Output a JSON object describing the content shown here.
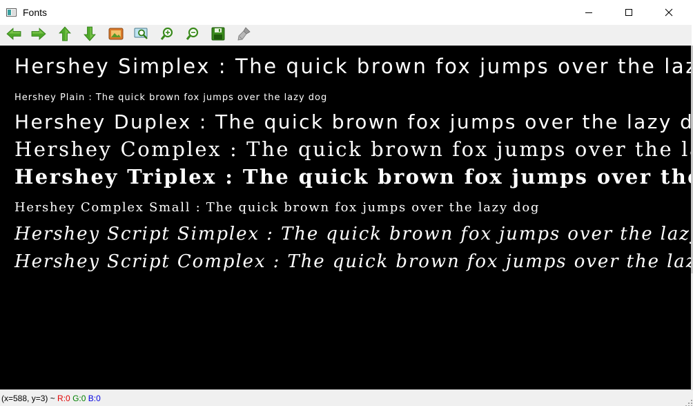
{
  "window": {
    "title": "Fonts"
  },
  "toolbar": {
    "buttons": [
      {
        "icon": "arrow-left-icon",
        "name": "pan-left-button"
      },
      {
        "icon": "arrow-right-icon",
        "name": "pan-right-button"
      },
      {
        "icon": "arrow-up-icon",
        "name": "pan-up-button"
      },
      {
        "icon": "arrow-down-icon",
        "name": "pan-down-button"
      },
      {
        "icon": "image-icon",
        "name": "zoom-original-button"
      },
      {
        "icon": "zoom-fit-icon",
        "name": "zoom-fit-button"
      },
      {
        "icon": "zoom-in-icon",
        "name": "zoom-in-button"
      },
      {
        "icon": "zoom-out-icon",
        "name": "zoom-out-button"
      },
      {
        "icon": "save-icon",
        "name": "save-button"
      },
      {
        "icon": "properties-brush-icon",
        "name": "properties-button"
      }
    ],
    "accent_color": "#4fa82a"
  },
  "canvas": {
    "background": "#000000",
    "text_color": "#ffffff",
    "lines": [
      {
        "text": "Hershey Simplex : The quick brown fox jumps over the lazy dog",
        "style": "simplex"
      },
      {
        "text": "Hershey Plain : The quick brown fox jumps over the lazy dog",
        "style": "plain"
      },
      {
        "text": "Hershey Duplex : The quick brown fox jumps over the lazy dog",
        "style": "duplex"
      },
      {
        "text": "Hershey Complex : The quick brown fox jumps over the lazy dog",
        "style": "complex"
      },
      {
        "text": "Hershey Triplex : The quick brown fox jumps over the lazy dog",
        "style": "triplex"
      },
      {
        "text": "Hershey Complex Small : The quick brown fox jumps over the lazy dog",
        "style": "complex-small"
      },
      {
        "text": "Hershey Script Simplex : The quick brown fox jumps over the lazy dog",
        "style": "script-simplex"
      },
      {
        "text": "Hershey Script Complex : The quick brown fox jumps over the lazy dog",
        "style": "script-complex"
      }
    ]
  },
  "status": {
    "coords": "(x=588, y=3) ~ ",
    "r_label": "R:0",
    "g_label": "G:0",
    "b_label": "B:0",
    "r_color": "#e00000",
    "g_color": "#008000",
    "b_color": "#0000e0"
  }
}
